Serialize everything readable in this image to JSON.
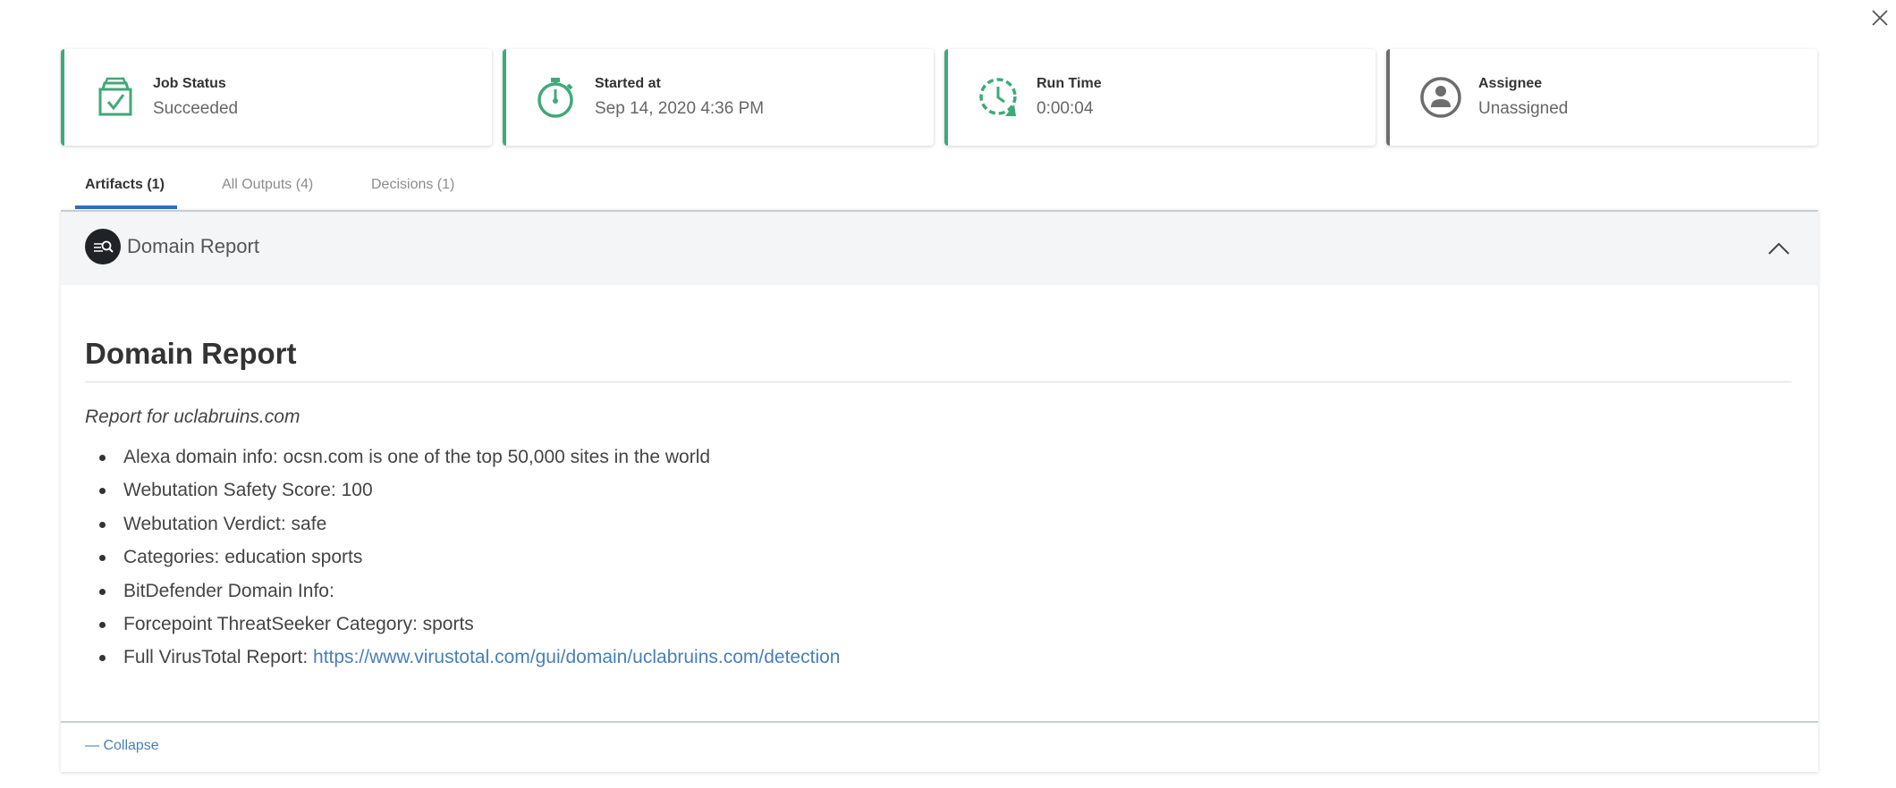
{
  "window": {
    "close_icon": "close-icon"
  },
  "summary_cards": [
    {
      "label": "Job Status",
      "value": "Succeeded",
      "icon": "job-status-icon"
    },
    {
      "label": "Started at",
      "value": "Sep 14, 2020 4:36 PM",
      "icon": "stopwatch-icon"
    },
    {
      "label": "Run Time",
      "value": "0:00:04",
      "icon": "run-time-icon"
    },
    {
      "label": "Assignee",
      "value": "Unassigned",
      "icon": "user-icon"
    }
  ],
  "colors": {
    "accent_green": "#3fa978",
    "accent_blue": "#2f6ebd",
    "link": "#4a7fb5",
    "gray": "#6d6d6d"
  },
  "tabs": [
    {
      "label": "Artifacts (1)",
      "active": true
    },
    {
      "label": "All Outputs (4)",
      "active": false
    },
    {
      "label": "Decisions (1)",
      "active": false
    }
  ],
  "artifact": {
    "header_title": "Domain Report",
    "heading": "Domain Report",
    "subtitle": "Report for uclabruins.com",
    "items": [
      {
        "text": "Alexa domain info: ocsn.com is one of the top 50,000 sites in the world"
      },
      {
        "text": "Webutation Safety Score: 100"
      },
      {
        "text": "Webutation Verdict: safe"
      },
      {
        "text": "Categories: education sports"
      },
      {
        "text": "BitDefender Domain Info:"
      },
      {
        "text": "Forcepoint ThreatSeeker Category: sports"
      },
      {
        "text": "Full VirusTotal Report: ",
        "link": "https://www.virustotal.com/gui/domain/uclabruins.com/detection"
      }
    ],
    "collapse_label": "— Collapse"
  }
}
